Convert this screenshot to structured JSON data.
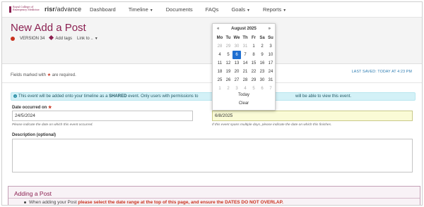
{
  "logo_text": "Royal College of Emergency Medicine",
  "brand": {
    "bold": "risr",
    "rest": "/advance"
  },
  "nav": {
    "dashboard": "Dashboard",
    "timeline": "Timeline",
    "documents": "Documents",
    "faqs": "FAQs",
    "goals": "Goals",
    "reports": "Reports"
  },
  "header": {
    "title": "New Add a Post",
    "version": "VERSION 34",
    "add_tags": "Add tags",
    "link_to": "Link to .."
  },
  "required_prefix": "Fields marked with",
  "required_suffix": "are required.",
  "last_saved": "LAST SAVED: TODAY AT 4:23 PM",
  "alert": {
    "part1": "This event will be added onto your timeline as a",
    "shared": "SHARED",
    "part2": "event. Only users with permissions to",
    "part3": "will be able to view this event."
  },
  "fields": {
    "date_occurred_label": "Date occurred on",
    "date_occurred_value": "24/5/2024",
    "date_occurred_hint": "Please indicate the date on which this event occurred.",
    "end_date_value": "6/8/2025",
    "end_date_hint": "If this event spans multiple days, please indicate the date on which this finishes.",
    "description_label": "Description (optional)"
  },
  "panel": {
    "title": "Adding a Post",
    "text_plain": "When adding your Post",
    "text_em": "please select the date range at the top of this page, and ensure the DATES DO NOT OVERLAP."
  },
  "datepicker": {
    "prev": "«",
    "next": "»",
    "month": "August 2025",
    "dow": [
      "Mo",
      "Tu",
      "We",
      "Th",
      "Fr",
      "Sa",
      "Su"
    ],
    "weeks": [
      [
        "28",
        "29",
        "30",
        "31",
        "1",
        "2",
        "3"
      ],
      [
        "4",
        "5",
        "6",
        "7",
        "8",
        "9",
        "10"
      ],
      [
        "11",
        "12",
        "13",
        "14",
        "15",
        "16",
        "17"
      ],
      [
        "18",
        "19",
        "20",
        "21",
        "22",
        "23",
        "24"
      ],
      [
        "25",
        "26",
        "27",
        "28",
        "29",
        "30",
        "31"
      ],
      [
        "1",
        "2",
        "3",
        "4",
        "5",
        "6",
        "7"
      ]
    ],
    "selected": "6",
    "today": "Today",
    "clear": "Clear"
  }
}
